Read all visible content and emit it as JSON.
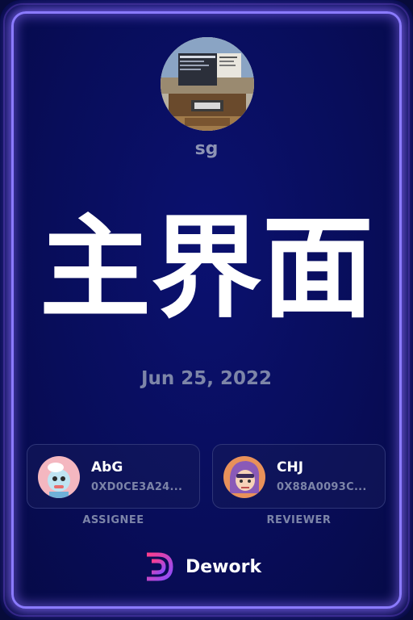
{
  "user": {
    "name": "sg"
  },
  "task": {
    "title": "主界面",
    "date": "Jun 25, 2022"
  },
  "assignee": {
    "name": "AbG",
    "address": "0XD0CE3A24...",
    "role": "ASSIGNEE"
  },
  "reviewer": {
    "name": "CHJ",
    "address": "0X88A0093C...",
    "role": "REVIEWER"
  },
  "brand": {
    "name": "Dework"
  },
  "colors": {
    "background": "#080d5a",
    "glow_border": "#8b7bff",
    "muted_text": "#7d85a8",
    "brand_gradient_start": "#ff3d8b",
    "brand_gradient_end": "#8a4dff"
  }
}
